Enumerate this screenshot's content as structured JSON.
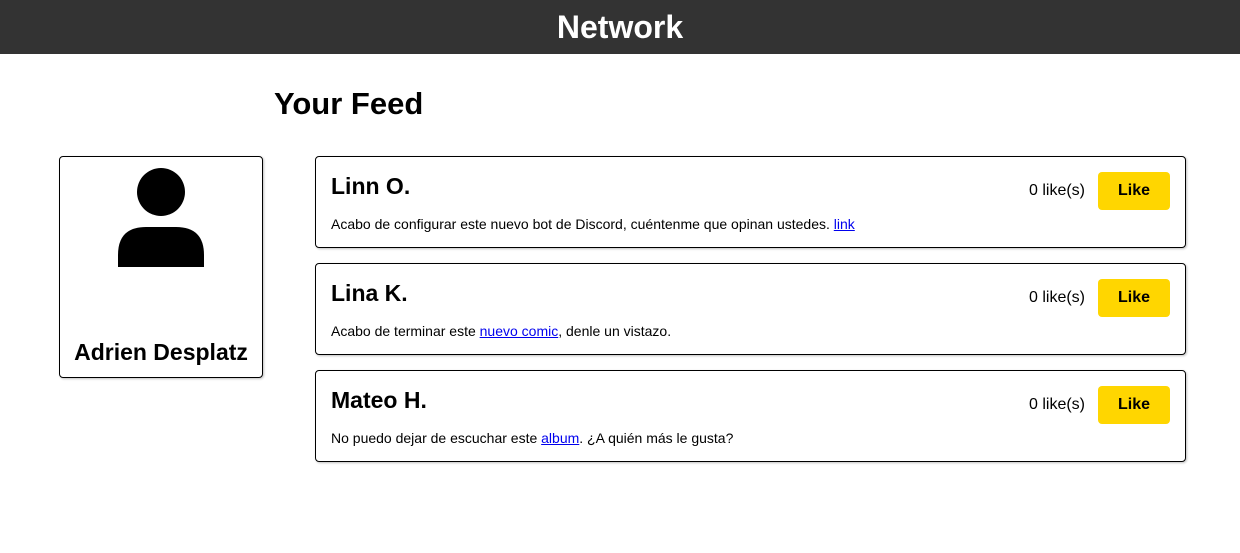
{
  "header": {
    "title": "Network"
  },
  "feed": {
    "title": "Your Feed"
  },
  "profile": {
    "name": "Adrien Desplatz",
    "icon": "user-avatar-icon"
  },
  "colors": {
    "topbar": "#333333",
    "like_button": "#FFD600",
    "link": "#0000EE"
  },
  "posts": [
    {
      "author": "Linn O.",
      "text_before": "Acabo de configurar este nuevo bot de Discord, cuéntenme que opinan ustedes. ",
      "link_text": "link",
      "text_after": "",
      "likes_text": "0 like(s)",
      "like_label": "Like"
    },
    {
      "author": "Lina K.",
      "text_before": "Acabo de terminar este ",
      "link_text": "nuevo comic",
      "text_after": ", denle un vistazo.",
      "likes_text": "0 like(s)",
      "like_label": "Like"
    },
    {
      "author": "Mateo H.",
      "text_before": "No puedo dejar de escuchar este ",
      "link_text": "album",
      "text_after": ". ¿A quién más le gusta?",
      "likes_text": "0 like(s)",
      "like_label": "Like"
    }
  ]
}
